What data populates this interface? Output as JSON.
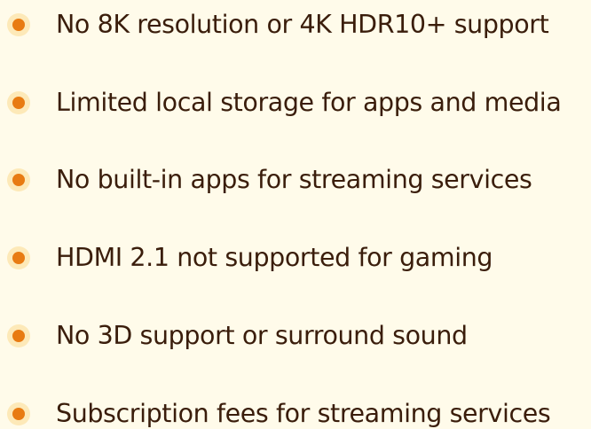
{
  "accent_color": "#e87b12",
  "bullet_halo_color": "#fde9b8",
  "text_color": "#3a1d0b",
  "background_color": "#fffbea",
  "items": [
    {
      "label": "No 8K resolution or 4K HDR10+ support"
    },
    {
      "label": "Limited local storage for apps and media"
    },
    {
      "label": "No built-in apps for streaming services"
    },
    {
      "label": "HDMI 2.1 not supported for gaming"
    },
    {
      "label": "No 3D support or surround sound"
    },
    {
      "label": "Subscription fees for streaming services"
    }
  ]
}
